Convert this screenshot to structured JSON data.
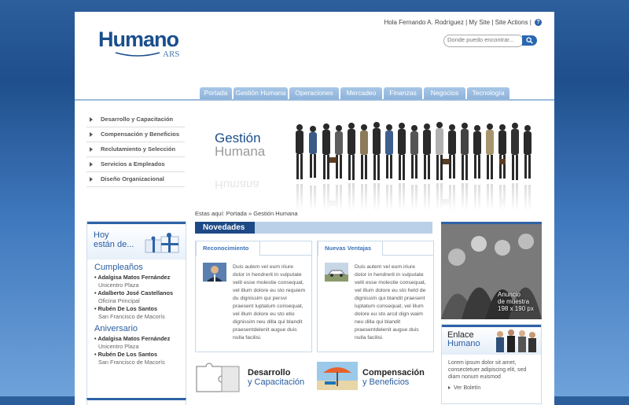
{
  "brand": {
    "name": "Humano",
    "suffix": "ARS"
  },
  "userbar": {
    "greeting": "Hola Fernando A. Rodríguez",
    "sep": "|",
    "my_site": "My Site",
    "site_actions": "Site Actions",
    "help": "?"
  },
  "search": {
    "placeholder": "Donde puedo encontrar..."
  },
  "nav": {
    "tabs": [
      "Portada",
      "Gestión Humana",
      "Operaciones",
      "Mercadeo",
      "Finanzas",
      "Negocios",
      "Tecnología"
    ]
  },
  "sidebar": {
    "items": [
      "Desarrollo y Capacitación",
      "Compensación y Beneficios",
      "Reclutamiento y Selección",
      "Servicios a Empleados",
      "Diseño Organizacional"
    ]
  },
  "hero": {
    "title_line1": "Gestión",
    "title_line2": "Humana"
  },
  "breadcrumb": {
    "prefix": "Estas aquí:",
    "root": "Portada",
    "sep": "»",
    "current": "Gestión Humana"
  },
  "hoy": {
    "title_line1": "Hoy",
    "title_line2": "están de...",
    "cumpleanos_title": "Cumpleaños",
    "cumpleanos": [
      {
        "name": "Adalgisa Matos Fernández",
        "place": "Unicentro Plaza"
      },
      {
        "name": "Adalberto José Castellanos",
        "place": "Oficina Principal"
      },
      {
        "name": "Rubén De Los Santos",
        "place": "San Francisco de Macorís"
      }
    ],
    "aniversario_title": "Aniversario",
    "aniversario": [
      {
        "name": "Adalgisa Matos Fernández",
        "place": "Unicentro Plaza"
      },
      {
        "name": "Rubén De Los Santos",
        "place": "San Francisco de Macorís"
      }
    ]
  },
  "novedades": {
    "title": "Novedades",
    "cards": [
      {
        "tab": "Reconocimiento",
        "text": "Duis autem vel eum iriure dolor in hendrerit in vulputate velit esse molestie consequat, vel illum dolore eu sto requiem du dignissim qui persvi praesent luptatum consequat, vel illum dolore eu sto etio dignissim neu dilla qui blandit praesentdelenit augue duis nulla facilisi."
      },
      {
        "tab": "Nuevas Ventajas",
        "text": "Duis autem vel eum iriure dolor in hendrerit in vulputate velit esse molestie consequat, vel illum dolore eu sto hetd de dignissim qui blandit praesent luptatum consequat, vel illum dolore eu sto arcd dign waim neu dilla qui blandit praesentdelenit augue duis nulla facilisi."
      }
    ]
  },
  "features": [
    {
      "line1": "Desarrollo",
      "line2": "y Capacitación"
    },
    {
      "line1": "Compensación",
      "line2": "y Beneficios"
    }
  ],
  "ad": {
    "line1": "Anuncio",
    "line2": "de muestra",
    "line3": "198 x 190 px"
  },
  "enlace": {
    "title_line1": "Enlace",
    "title_line2": "Humano",
    "body": "Lorem ipsum dolor sit amet, consectetuer adipiscing elit, sed diam nonum euismod",
    "link": "Ver Boletín"
  },
  "colors": {
    "brand_blue": "#1a4e8c",
    "accent_blue": "#2e63a6",
    "tab_blue": "#9bbbdc"
  }
}
